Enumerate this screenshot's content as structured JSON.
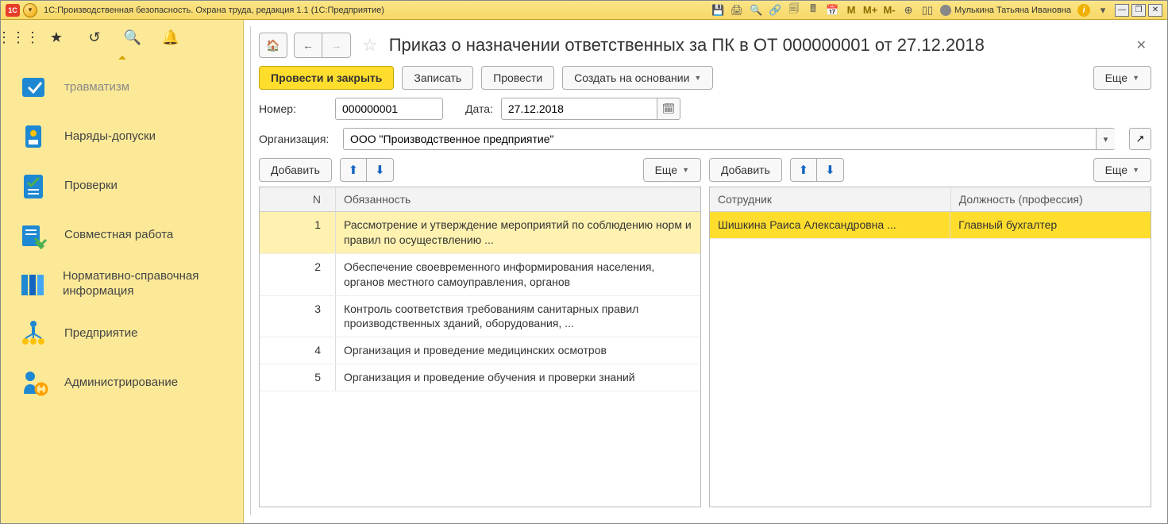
{
  "titlebar": {
    "logo_text": "1C",
    "app_title": "1С:Производственная безопасность. Охрана труда, редакция 1.1  (1С:Предприятие)",
    "m_labels": [
      "M",
      "M+",
      "M-"
    ],
    "user_name": "Мулькина Татьяна Ивановна"
  },
  "sidebar": {
    "items": [
      {
        "label": "травматизм",
        "dim": true
      },
      {
        "label": "Наряды-допуски"
      },
      {
        "label": "Проверки"
      },
      {
        "label": "Совместная работа"
      },
      {
        "label": "Нормативно-справочная информация"
      },
      {
        "label": "Предприятие"
      },
      {
        "label": "Администрирование"
      }
    ]
  },
  "header": {
    "title": "Приказ о назначении ответственных за ПК в ОТ 000000001 от 27.12.2018"
  },
  "toolbar": {
    "post_close": "Провести и закрыть",
    "save": "Записать",
    "post": "Провести",
    "create_based": "Создать на основании",
    "more": "Еще"
  },
  "form": {
    "number_label": "Номер:",
    "number_value": "000000001",
    "date_label": "Дата:",
    "date_value": "27.12.2018",
    "org_label": "Организация:",
    "org_value": "ООО \"Производственное предприятие\""
  },
  "left_table": {
    "add": "Добавить",
    "more": "Еще",
    "columns": {
      "n": "N",
      "duty": "Обязанность"
    },
    "rows": [
      {
        "n": "1",
        "duty": "Рассмотрение и утверждение мероприятий по соблюдению норм и правил по осуществлению ...",
        "selected": true
      },
      {
        "n": "2",
        "duty": "Обеспечение своевременного информирования населения, органов местного самоуправления, органов"
      },
      {
        "n": "3",
        "duty": "Контроль соответствия требованиям санитарных правил производственных зданий, оборудования, ..."
      },
      {
        "n": "4",
        "duty": "Организация и проведение медицинских осмотров"
      },
      {
        "n": "5",
        "duty": "Организация и проведение обучения и проверки знаний"
      }
    ]
  },
  "right_table": {
    "add": "Добавить",
    "more": "Еще",
    "columns": {
      "employee": "Сотрудник",
      "position": "Должность (профессия)"
    },
    "rows": [
      {
        "employee": "Шишкина Раиса Александровна ...",
        "position": "Главный бухгалтер",
        "highlight": true
      }
    ]
  }
}
